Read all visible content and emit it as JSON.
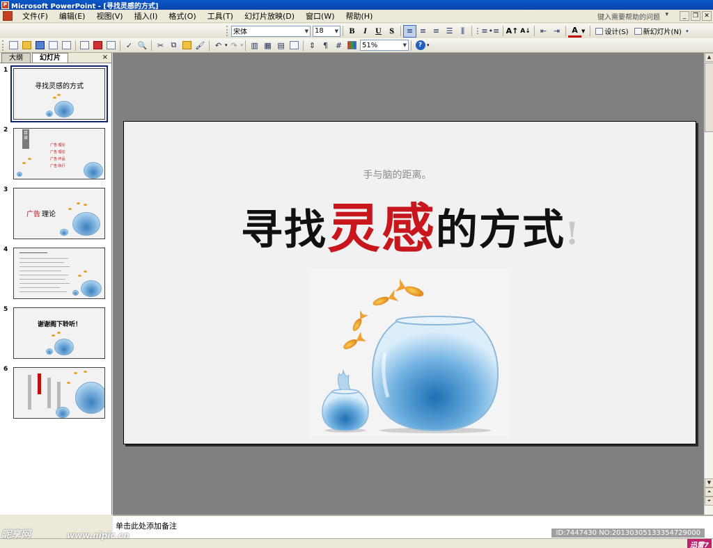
{
  "titlebar": {
    "title": "Microsoft PowerPoint - [寻找灵感的方式]"
  },
  "menu": {
    "items": [
      "文件(F)",
      "编辑(E)",
      "视图(V)",
      "插入(I)",
      "格式(O)",
      "工具(T)",
      "幻灯片放映(D)",
      "窗口(W)",
      "帮助(H)"
    ],
    "help_placeholder": "键入需要帮助的问题"
  },
  "format_toolbar": {
    "font_name": "宋体",
    "font_size": "18",
    "bold": "B",
    "italic": "I",
    "underline": "U",
    "shadow": "S",
    "design_label": "设计(S)",
    "new_slide_label": "新幻灯片(N)"
  },
  "standard_toolbar": {
    "zoom": "51%"
  },
  "pane": {
    "tabs": [
      "大纲",
      "幻灯片"
    ],
    "close": "×",
    "thumbnails": [
      {
        "num": "1",
        "title": "寻找灵感的方式"
      },
      {
        "num": "2",
        "tab": "目录",
        "items": [
          "广告·理论",
          "广告·理论",
          "广告·作品",
          "广告·执行"
        ]
      },
      {
        "num": "3",
        "title_prefix": "广告",
        "title_suffix": "理论"
      },
      {
        "num": "4"
      },
      {
        "num": "5",
        "title": "谢谢阁下聆听！"
      },
      {
        "num": "6"
      }
    ]
  },
  "slide": {
    "subtitle": "手与脑的距离。",
    "title_part1": "寻找",
    "title_accent": "灵感",
    "title_part2": "的方式",
    "title_exclaim": "!"
  },
  "notes": {
    "placeholder": "单击此处添加备注"
  },
  "watermark": {
    "id_text": "ID:7447430 NO:20130305133354729000",
    "site": "昵享网",
    "url": "www.nipic.cn",
    "brand": "迅雷7"
  },
  "icons": [
    "app-icon",
    "new-icon",
    "open-icon",
    "save-icon",
    "permission-icon",
    "email-icon",
    "print-icon",
    "pdf-icon",
    "print-preview-icon",
    "spelling-icon",
    "research-icon",
    "cut-icon",
    "copy-icon",
    "paste-icon",
    "format-painter-icon",
    "undo-icon",
    "redo-icon",
    "insert-chart-icon",
    "insert-table-icon",
    "tables-borders-icon",
    "insert-hyperlink-icon",
    "expand-icon",
    "show-formatting-icon",
    "grid-icon",
    "color-grayscale-icon",
    "help-icon"
  ],
  "colors": {
    "accent_red": "#c8161d",
    "title_blue": "#0a58c8",
    "slide_area_gray": "#808080"
  }
}
